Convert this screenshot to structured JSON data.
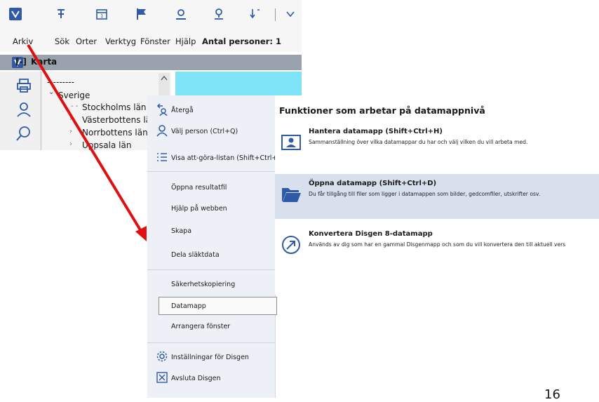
{
  "menubar": {
    "arkiv": "Arkiv",
    "sok": "Sök",
    "orter": "Orter",
    "verktyg": "Verktyg",
    "fonster": "Fönster",
    "hjalp": "Hjälp",
    "antal_personer": "Antal personer: 1"
  },
  "window": {
    "box_marker": "[-]",
    "title": "Karta"
  },
  "tree": {
    "dashes": "---------",
    "root": "Sverige",
    "items": [
      "Stockholms län",
      "Västerbottens län",
      "Norrbottens län",
      "Uppsala län"
    ]
  },
  "menu": {
    "items": [
      {
        "label": "Återgå",
        "icon": "back-arrow-icon"
      },
      {
        "label": "Välj person (Ctrl+Q)",
        "icon": "person-icon"
      },
      {
        "label": "Visa att-göra-listan (Shift+Ctrl+L)",
        "icon": "checklist-icon"
      },
      {
        "label": "Öppna resultatfil"
      },
      {
        "label": "Hjälp på webben"
      },
      {
        "label": "Skapa"
      },
      {
        "label": "Dela släktdata"
      },
      {
        "label": "Säkerhetskopiering"
      },
      {
        "label": "Datamapp"
      },
      {
        "label": "Arrangera fönster"
      },
      {
        "label": "Inställningar för Disgen",
        "icon": "gear-icon"
      },
      {
        "label": "Avsluta Disgen",
        "icon": "close-box-icon"
      }
    ]
  },
  "panel": {
    "heading": "Funktioner som arbetar på datamappnivå",
    "functions": [
      {
        "title": "Hantera datamapp (Shift+Ctrl+H)",
        "desc": "Sammanställning över vilka datamappar du har och välj vilken du vill arbeta med.",
        "icon": "id-card-icon"
      },
      {
        "title": "Öppna datamapp (Shift+Ctrl+D)",
        "desc": "Du får tillgång till filer som ligger i datamappen som bilder, gedcomfiler, utskrifter osv.",
        "icon": "open-folder-icon"
      },
      {
        "title": "Konvertera Disgen 8-datamapp",
        "desc": "Används av dig som har en gammal Disgenmapp och som du vill konvertera den till aktuell vers",
        "icon": "convert-arrow-icon"
      }
    ]
  },
  "page_number": "16",
  "colors": {
    "accent": "#2f5aa8",
    "arrow": "#e01010",
    "highlight": "#d9e0ed",
    "map": "#7fe3f7"
  }
}
